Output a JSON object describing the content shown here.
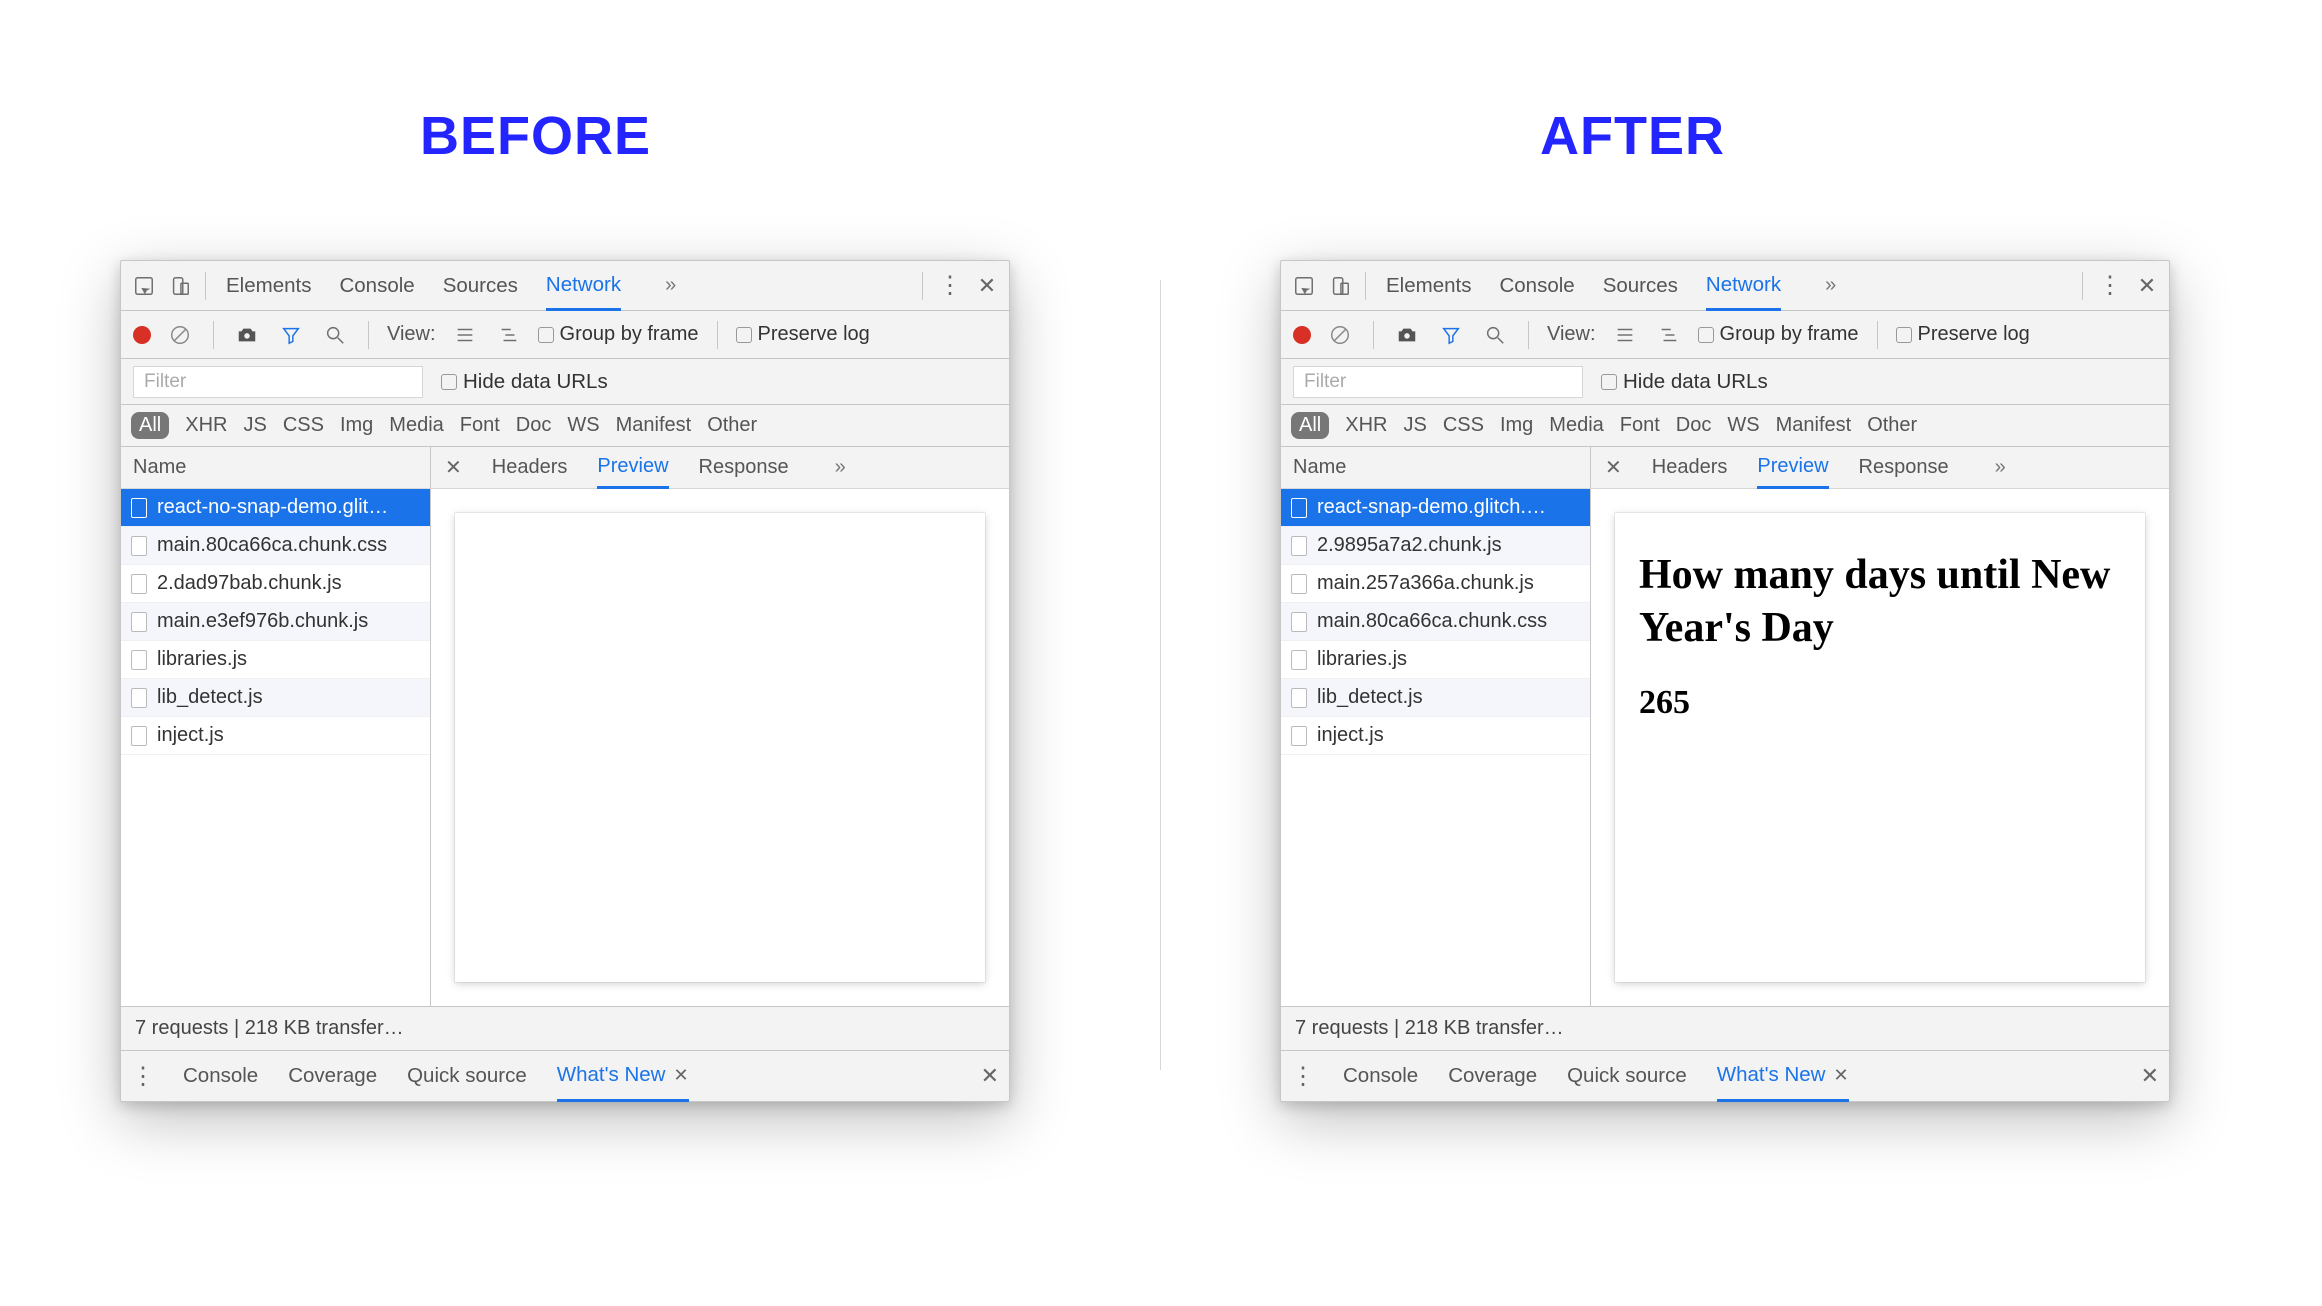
{
  "headings": {
    "before": "BEFORE",
    "after": "AFTER"
  },
  "top_tabs": [
    "Elements",
    "Console",
    "Sources",
    "Network"
  ],
  "top_tabs_selected": "Network",
  "toolbar": {
    "view_label": "View:",
    "group_by_frame": "Group by frame",
    "preserve_log": "Preserve log"
  },
  "filter": {
    "placeholder": "Filter",
    "hide_data_urls": "Hide data URLs"
  },
  "type_chips": [
    "All",
    "XHR",
    "JS",
    "CSS",
    "Img",
    "Media",
    "Font",
    "Doc",
    "WS",
    "Manifest",
    "Other"
  ],
  "type_chips_selected": "All",
  "left_header": "Name",
  "detail_tabs": [
    "Headers",
    "Preview",
    "Response"
  ],
  "detail_tabs_selected": "Preview",
  "before": {
    "requests": [
      "react-no-snap-demo.glit…",
      "main.80ca66ca.chunk.css",
      "2.dad97bab.chunk.js",
      "main.e3ef976b.chunk.js",
      "libraries.js",
      "lib_detect.js",
      "inject.js"
    ],
    "selected_request_index": 0,
    "preview_html": {
      "heading": "",
      "value": ""
    }
  },
  "after": {
    "requests": [
      "react-snap-demo.glitch.…",
      "2.9895a7a2.chunk.js",
      "main.257a366a.chunk.js",
      "main.80ca66ca.chunk.css",
      "libraries.js",
      "lib_detect.js",
      "inject.js"
    ],
    "selected_request_index": 0,
    "preview_html": {
      "heading": "How many days until New Year's Day",
      "value": "265"
    }
  },
  "status_bar": "7 requests | 218 KB transfer…",
  "drawer_tabs": [
    "Console",
    "Coverage",
    "Quick source",
    "What's New"
  ],
  "drawer_tabs_selected": "What's New"
}
